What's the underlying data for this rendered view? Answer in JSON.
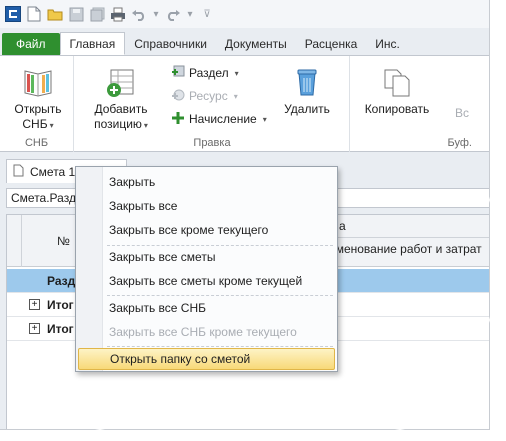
{
  "quick_access": {
    "icons": [
      "app-logo-icon",
      "new-document-icon",
      "open-folder-icon",
      "save-icon",
      "save-all-icon",
      "print-icon",
      "undo-icon",
      "redo-icon",
      "customize-icon"
    ]
  },
  "ribbon_tabs": [
    {
      "label": "Файл"
    },
    {
      "label": "Главная"
    },
    {
      "label": "Справочники"
    },
    {
      "label": "Документы"
    },
    {
      "label": "Расценка"
    },
    {
      "label": "Инс."
    }
  ],
  "ribbon": {
    "snb": {
      "open_label_1": "Открыть",
      "open_label_2": "СНБ",
      "caption": "СНБ"
    },
    "edit": {
      "add_label_1": "Добавить",
      "add_label_2": "позицию",
      "section_label": "Раздел",
      "resource_label": "Ресурс",
      "accrual_label": "Начисление",
      "delete_label": "Удалить",
      "caption": "Правка"
    },
    "buffer": {
      "copy_label": "Копировать",
      "paste_label": "Вс",
      "caption": "Буф."
    }
  },
  "doc_tab": {
    "label": "Смета 1"
  },
  "path_bar": {
    "text": "Смета.Разде"
  },
  "grid": {
    "header_num": "№",
    "header_group": "а",
    "header_name": "именование работ и затрат",
    "rows": [
      {
        "label": "Разд"
      },
      {
        "label": "Итог"
      },
      {
        "label": "Итог"
      }
    ]
  },
  "context_menu": {
    "items": [
      {
        "label": "Закрыть"
      },
      {
        "label": "Закрыть все"
      },
      {
        "label": "Закрыть все кроме текущего"
      },
      {
        "label": "Закрыть все сметы"
      },
      {
        "label": "Закрыть все сметы кроме текущей"
      },
      {
        "label": "Закрыть все СНБ"
      },
      {
        "label": "Закрыть все СНБ кроме текущего"
      },
      {
        "label": "Открыть папку со сметой"
      }
    ]
  },
  "colors": {
    "file_tab": "#2f8f2f",
    "section_row": "#9dc9ec",
    "menu_highlight": "#f8d978"
  }
}
